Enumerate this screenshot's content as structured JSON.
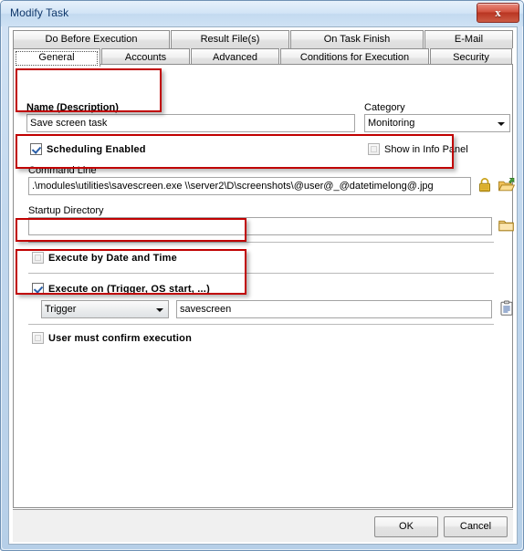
{
  "window": {
    "title": "Modify Task",
    "close_label": "x",
    "close_icon": "close-icon"
  },
  "tabs": {
    "top_row": [
      {
        "label": "Do Before Execution",
        "selected": false
      },
      {
        "label": "Result File(s)",
        "selected": false
      },
      {
        "label": "On Task Finish",
        "selected": false
      },
      {
        "label": "E-Mail",
        "selected": false
      }
    ],
    "bottom_row": [
      {
        "label": "General",
        "selected": true
      },
      {
        "label": "Accounts",
        "selected": false
      },
      {
        "label": "Advanced",
        "selected": false
      },
      {
        "label": "Conditions for Execution",
        "selected": false
      },
      {
        "label": "Security",
        "selected": false
      }
    ]
  },
  "form": {
    "name": {
      "label": "Name (Description)",
      "value": "Save screen task",
      "placeholder": ""
    },
    "category": {
      "label": "Category",
      "value": "Monitoring"
    },
    "scheduling_enabled": {
      "label": "Scheduling Enabled",
      "checked": true
    },
    "show_in_info_panel": {
      "label": "Show in Info Panel",
      "checked": false
    },
    "command_line": {
      "label": "Command Line",
      "value": ".\\modules\\utilities\\savescreen.exe \\\\server2\\D\\screenshots\\@user@_@datetimelong@.jpg",
      "placeholder": "",
      "lock_icon": "lock-icon",
      "browse_icon": "open-folder-icon"
    },
    "startup_directory": {
      "label": "Startup Directory",
      "value": "",
      "placeholder": "",
      "browse_icon": "folder-icon"
    },
    "execute_by_date_time": {
      "label": "Execute by Date and Time",
      "checked": false
    },
    "execute_on": {
      "label": "Execute on (Trigger, OS start, ...)",
      "checked": true,
      "type_value": "Trigger",
      "name_value": "savescreen",
      "name_placeholder": "",
      "list_icon": "clipboard-icon"
    },
    "user_must_confirm": {
      "label": "User must confirm execution",
      "checked": false
    }
  },
  "footer": {
    "ok_label": "OK",
    "cancel_label": "Cancel"
  },
  "colors": {
    "annotation": "#c00000",
    "titlebar_text": "#10386b",
    "close_button": "#b93522",
    "checkmark": "#2a5fa8"
  }
}
